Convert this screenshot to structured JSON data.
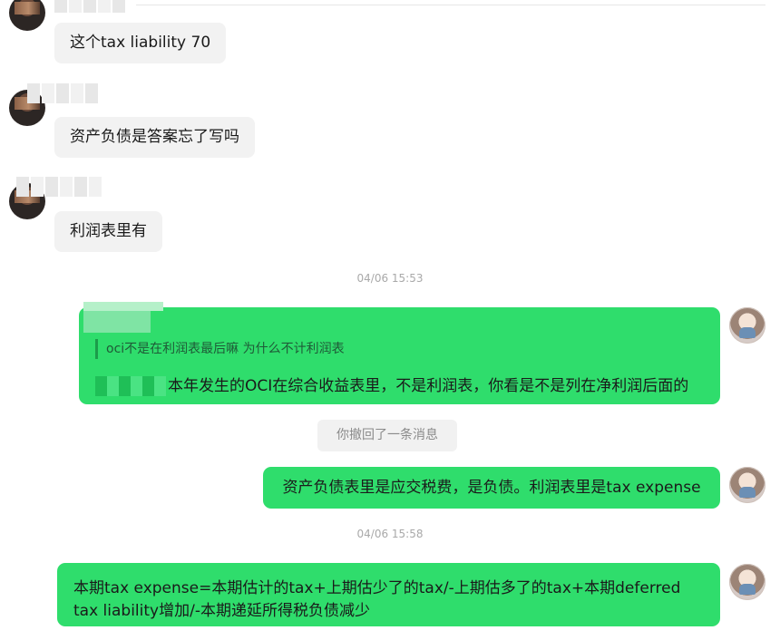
{
  "messages": [
    {
      "side": "left",
      "text": "这个tax liability 70"
    },
    {
      "side": "left",
      "text": "资产负债是答案忘了写吗"
    },
    {
      "side": "left",
      "text": "利润表里有"
    }
  ],
  "timestamps": [
    "04/06 15:53",
    "04/06 15:58"
  ],
  "quote": {
    "quoted_text": "oci不是在利润表最后嘛 为什么不计利润表",
    "reply_text": "本年发生的OCI在综合收益表里，不是利润表，你看是不是列在净利润后面的"
  },
  "recall_notice": "你撤回了一条消息",
  "reply_tax": "资产负债表里是应交税费，是负债。利润表里是tax expense",
  "reply_formula": {
    "line1": "本期tax expense=本期估计的tax+上期估少了的tax/-上期估多了的tax+本期deferred",
    "line2": "tax liability增加/-本期递延所得税负债减少"
  },
  "colors": {
    "my_bubble": "#2fdd6c",
    "their_bubble": "#f2f2f2",
    "timestamp": "#a9a9a9"
  },
  "icons": [
    "contact-avatar-icon",
    "self-avatar-icon"
  ]
}
